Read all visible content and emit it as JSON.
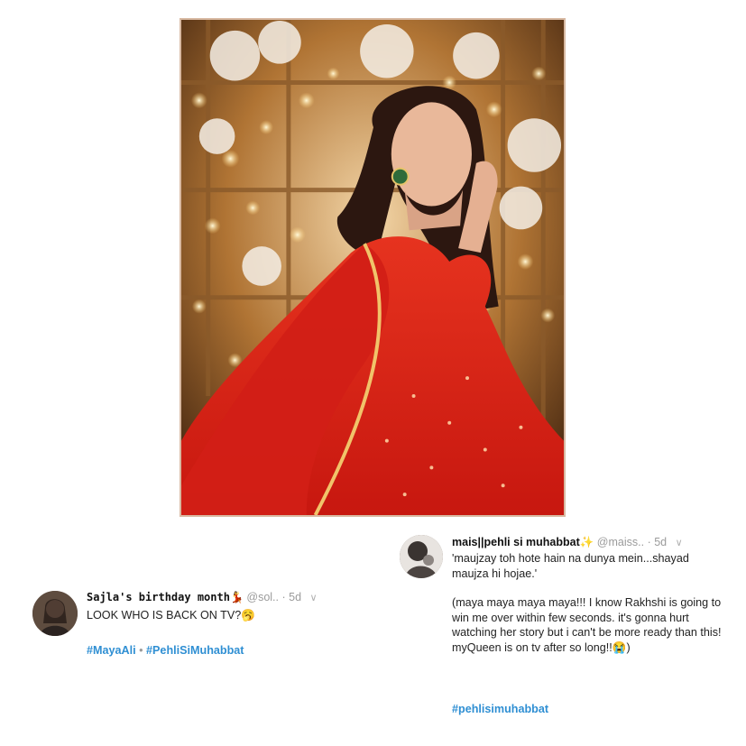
{
  "photo": {
    "description_icon": "photo-woman-red-dress"
  },
  "tweet_left": {
    "display_name": "Sajla's birthday month💃",
    "handle": "@sol..",
    "age": "· 5d",
    "chevron_icon": "chevron-down-icon",
    "text": "LOOK WHO IS BACK ON TV?🥱",
    "hashtags": [
      "#MayaAli",
      "#PehliSiMuhabbat"
    ],
    "hashtag_separator": " • "
  },
  "tweet_right": {
    "display_name": "mais||pehli si muhabbat✨",
    "handle": "@maiss..",
    "age": "· 5d",
    "chevron_icon": "chevron-down-icon",
    "paragraph1": "'maujzay toh hote hain na dunya mein...shayad maujza hi hojae.'",
    "paragraph2": "(maya maya maya maya!!! I know Rakhshi is going to win me over within few seconds. it's gonna hurt watching her story but i can't be more ready than this! myQueen is on tv after so long!!😭)",
    "hashtag": "#pehlisimuhabbat"
  },
  "colors": {
    "hashtag": "#2f8fd3",
    "dress_red": "#e0241a",
    "meta_gray": "#9b9b9b"
  }
}
